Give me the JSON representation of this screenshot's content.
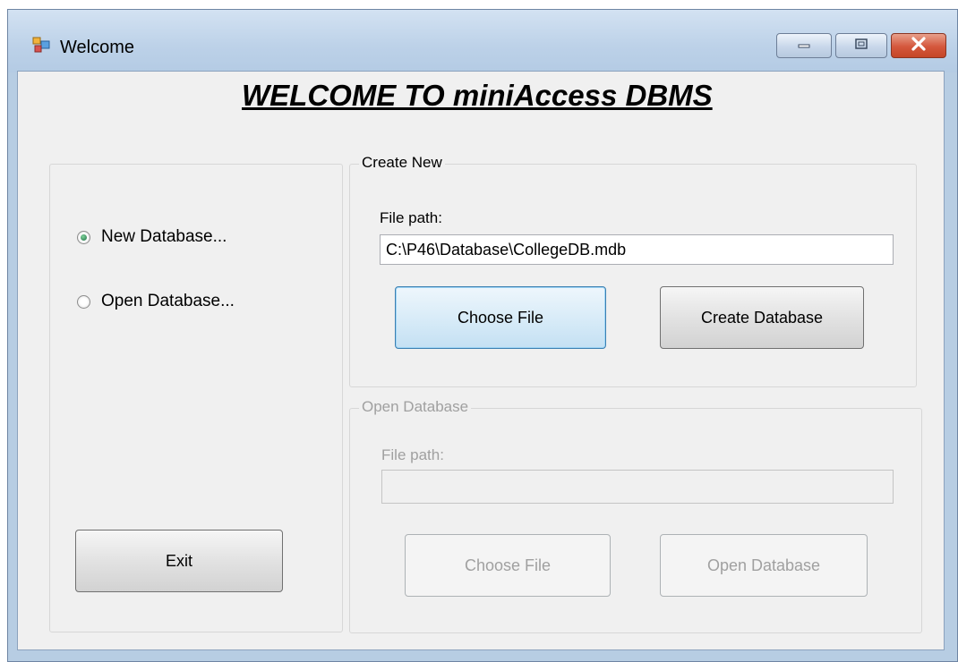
{
  "window": {
    "title": "Welcome"
  },
  "heading": "WELCOME TO miniAccess DBMS",
  "mode_options": {
    "new_database": {
      "label": "New Database...",
      "checked": true
    },
    "open_database": {
      "label": "Open Database...",
      "checked": false
    }
  },
  "create_group": {
    "legend": "Create New",
    "file_path_label": "File path:",
    "file_path_value": "C:\\P46\\Database\\CollegeDB.mdb",
    "choose_file_label": "Choose File",
    "create_database_label": "Create Database"
  },
  "open_group": {
    "legend": "Open Database",
    "file_path_label": "File path:",
    "file_path_value": "",
    "choose_file_label": "Choose File",
    "open_database_label": "Open Database",
    "enabled": false
  },
  "exit_label": "Exit",
  "icons": {
    "app": "app-window-icon",
    "minimize": "minimize-icon",
    "maximize": "maximize-icon",
    "close": "close-icon"
  },
  "colors": {
    "close_button": "#d4573c",
    "title_bar": "#bcd1e8",
    "client_background": "#f0f0f0",
    "radio_selected": "#1f6e46",
    "focused_button_border": "#3c7fb1",
    "disabled_text": "#a0a0a0"
  }
}
